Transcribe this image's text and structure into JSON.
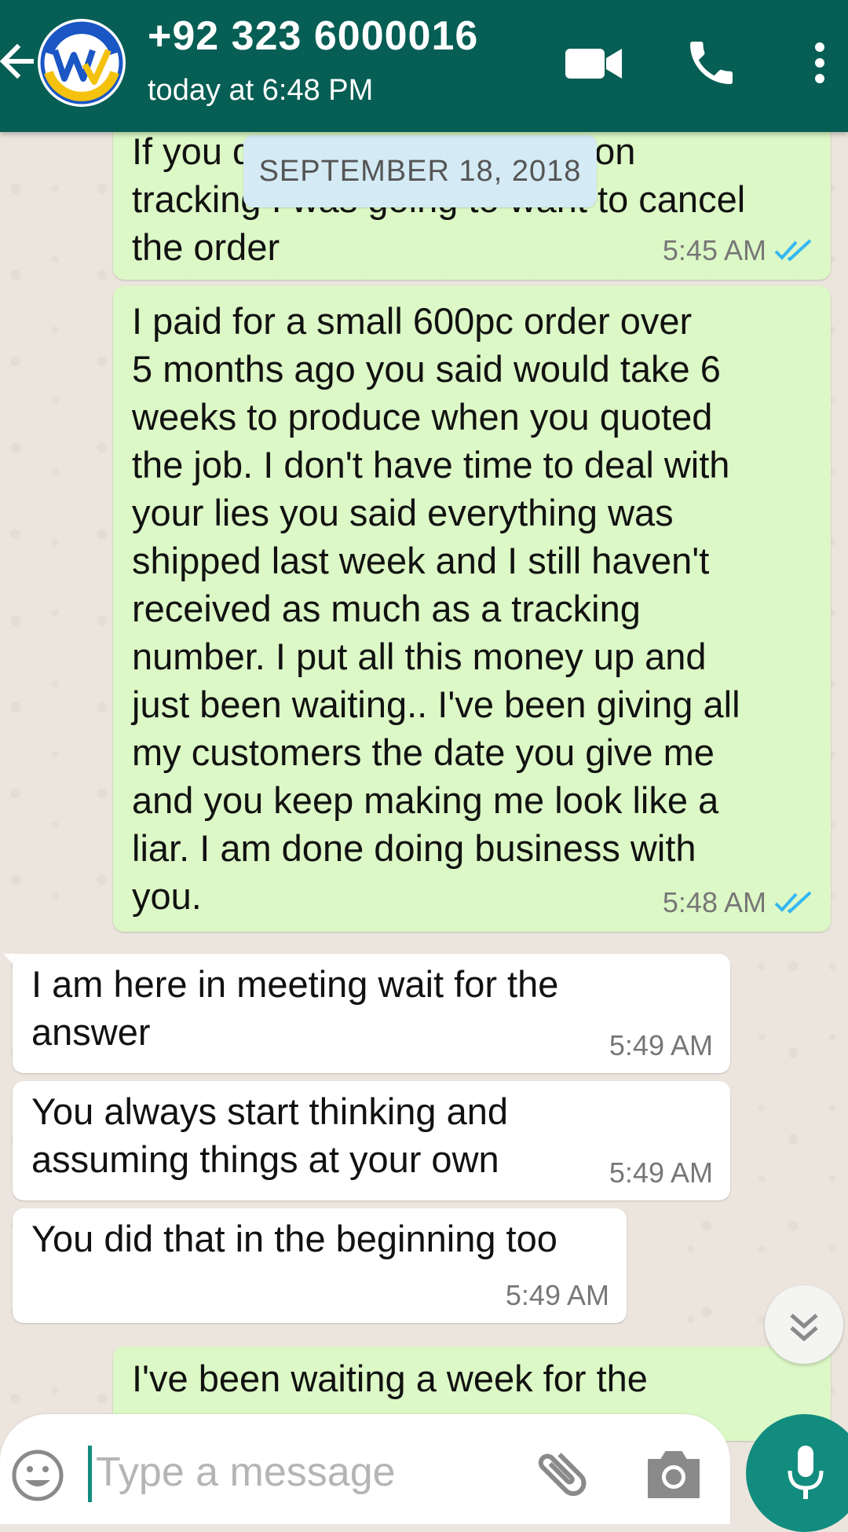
{
  "header": {
    "contact_name": "+92 323 6000016",
    "status": "today at 6:48 PM",
    "accent": "#075e54"
  },
  "date_chip": "SEPTEMBER 18, 2018",
  "messages": [
    {
      "direction": "outgoing",
      "text": "If you didn't have an update on\ntracking I was going to want to cancel\nthe order",
      "visible_text_top": "If you",
      "time": "5:45 AM",
      "status": "read"
    },
    {
      "direction": "outgoing",
      "text": "I paid for a small 600pc order over\n5 months ago you said would take 6\nweeks to produce when you quoted\nthe job.  I don't have time to deal with\nyour lies   you said everything was\nshipped last week and I still haven't\nreceived as much as a tracking\nnumber.  I put all this money up and\njust been waiting..  I've been giving all\nmy customers the date you give me\nand you keep making me look like a\nliar.   I am done doing business with\nyou.",
      "time": "5:48 AM",
      "status": "read"
    },
    {
      "direction": "incoming",
      "text": "I am here in meeting wait for the\nanswer",
      "time": "5:49 AM"
    },
    {
      "direction": "incoming",
      "text": "You always start thinking and\nassuming things at your own",
      "time": "5:49 AM"
    },
    {
      "direction": "incoming",
      "text": "You did that in the beginning too",
      "time": "5:49 AM"
    },
    {
      "direction": "outgoing",
      "text": "I've been waiting a week for the",
      "time": ""
    }
  ],
  "input": {
    "placeholder": "Type a message"
  },
  "icons": {
    "back": "arrow-left-icon",
    "video": "video-camera-icon",
    "call": "phone-icon",
    "menu": "more-vertical-icon",
    "emoji": "emoji-icon",
    "attach": "paperclip-icon",
    "camera": "camera-icon",
    "mic": "microphone-icon",
    "scroll": "chevrons-down-icon"
  }
}
